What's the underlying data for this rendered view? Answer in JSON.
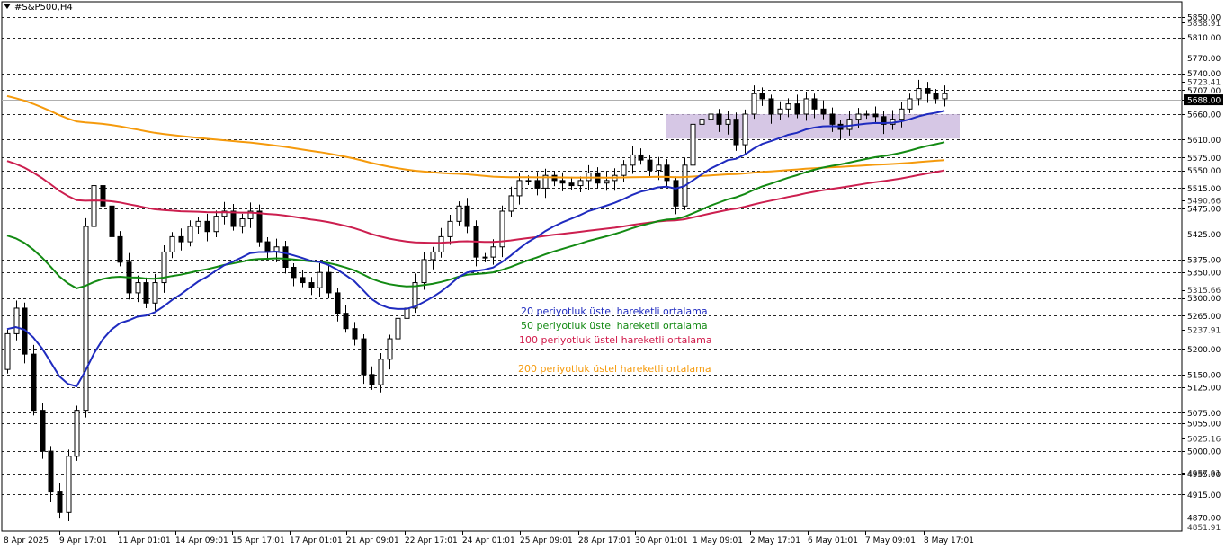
{
  "window": {
    "symbol_title": "#S&P500,H4",
    "menu_icon": "triangle-down-icon"
  },
  "chart_data": {
    "type": "candlestick",
    "title": "#S&P500,H4",
    "ylim": [
      4851.91,
      5862
    ],
    "y_tick_labels": [
      5850.0,
      5838.91,
      5810.0,
      5770.0,
      5740.0,
      5723.41,
      5707.0,
      5688.0,
      5660.0,
      5610.0,
      5575.0,
      5550.0,
      5515.0,
      5490.66,
      5475.0,
      5425.0,
      5375.0,
      5350.0,
      5315.66,
      5300.0,
      5265.0,
      5237.91,
      5200.0,
      5150.0,
      5125.0,
      5075.0,
      5055.0,
      5025.16,
      5000.0,
      4957.91,
      4955.0,
      4915.0,
      4870.0,
      4851.91
    ],
    "dashed_gridlines": [
      5850,
      5810,
      5770,
      5740,
      5707,
      5660,
      5610,
      5575,
      5550,
      5515,
      5475,
      5425,
      5375,
      5350,
      5300,
      5265,
      5200,
      5150,
      5125,
      5075,
      5055,
      5000,
      4955,
      4915,
      4870
    ],
    "current_price": 5688.0,
    "x_tick_labels": [
      "8 Apr 2025",
      "9 Apr 17:01",
      "11 Apr 01:01",
      "14 Apr 09:01",
      "15 Apr 17:01",
      "17 Apr 01:01",
      "21 Apr 09:01",
      "22 Apr 17:01",
      "24 Apr 01:01",
      "25 Apr 09:01",
      "28 Apr 17:01",
      "30 Apr 01:01",
      "1 May 09:01",
      "2 May 17:01",
      "6 May 01:01",
      "7 May 09:01",
      "8 May 17:01"
    ],
    "candles_close": [
      5230,
      5280,
      5190,
      5080,
      5000,
      4920,
      4880,
      4990,
      5080,
      5440,
      5520,
      5480,
      5420,
      5370,
      5310,
      5330,
      5290,
      5330,
      5390,
      5420,
      5410,
      5440,
      5450,
      5430,
      5460,
      5470,
      5440,
      5455,
      5470,
      5410,
      5390,
      5400,
      5360,
      5340,
      5330,
      5320,
      5350,
      5310,
      5270,
      5240,
      5220,
      5150,
      5130,
      5180,
      5220,
      5260,
      5280,
      5330,
      5375,
      5390,
      5420,
      5450,
      5480,
      5440,
      5380,
      5380,
      5400,
      5470,
      5500,
      5530,
      5530,
      5515,
      5540,
      5530,
      5525,
      5520,
      5530,
      5545,
      5525,
      5530,
      5540,
      5560,
      5580,
      5570,
      5550,
      5560,
      5530,
      5480,
      5560,
      5640,
      5650,
      5660,
      5640,
      5650,
      5600,
      5660,
      5700,
      5690,
      5660,
      5670,
      5680,
      5660,
      5690,
      5670,
      5660,
      5640,
      5630,
      5650,
      5660,
      5660,
      5655,
      5640,
      5650,
      5670,
      5690,
      5710,
      5700,
      5690,
      5700
    ],
    "highlight_zone": [
      5612,
      5660
    ],
    "annotations": [
      {
        "text": "20 periyotluk üstel hareketli ortalama",
        "color": "#1f2bbf"
      },
      {
        "text": "50 periyotluk üstel hareketli ortalama",
        "color": "#138a13"
      },
      {
        "text": "100 periyotluk üstel hareketli ortalama",
        "color": "#d11a4a"
      },
      {
        "text": "200 periyotluk üstel hareketli ortalama",
        "color": "#f59a0c"
      }
    ],
    "series_colors": {
      "ema20": "#1f2bbf",
      "ema50": "#138a13",
      "ema100": "#cc1f4f",
      "ema200": "#f59a0c",
      "zone": "#c8b4dc",
      "grid": "#000000"
    },
    "grid": true,
    "legend": "none"
  }
}
